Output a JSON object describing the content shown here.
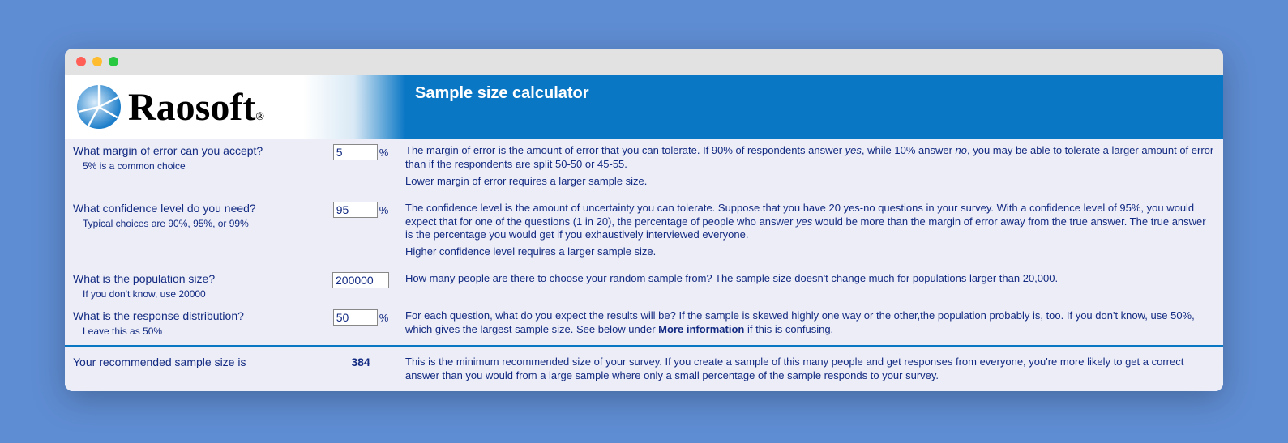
{
  "brand": {
    "name": "Raosoft",
    "registered": "®"
  },
  "header": {
    "title": "Sample size calculator"
  },
  "rows": {
    "margin": {
      "question": "What margin of error can you accept?",
      "hint": "5% is a common choice",
      "value": "5",
      "unit": "%",
      "desc_a": "The margin of error is the amount of error that you can tolerate. If 90% of respondents answer ",
      "desc_yes": "yes",
      "desc_b": ", while 10% answer ",
      "desc_no": "no",
      "desc_c": ", you may be able to tolerate a larger amount of error than if the respondents are split 50-50 or 45-55.",
      "desc_d": "Lower margin of error requires a larger sample size."
    },
    "confidence": {
      "question": "What confidence level do you need?",
      "hint": "Typical choices are 90%, 95%, or 99%",
      "value": "95",
      "unit": "%",
      "desc_a": "The confidence level is the amount of uncertainty you can tolerate. Suppose that you have 20 yes-no questions in your survey. With a confidence level of 95%, you would expect that for one of the questions (1 in 20), the percentage of people who answer ",
      "desc_yes": "yes",
      "desc_b": " would be more than the margin of error away from the true answer. The true answer is the percentage you would get if you exhaustively interviewed everyone.",
      "desc_c": "Higher confidence level requires a larger sample size."
    },
    "population": {
      "question": "What is the population size?",
      "hint": "If you don't know, use 20000",
      "value": "200000",
      "desc": "How many people are there to choose your random sample from? The sample size doesn't change much for populations larger than 20,000."
    },
    "response": {
      "question": "What is the response distribution?",
      "hint": "Leave this as 50%",
      "value": "50",
      "unit": "%",
      "desc_a": "For each question, what do you expect the results will be? If the sample is skewed highly one way or the other,the population probably is, too. If you don't know, use 50%, which gives the largest sample size. See below under ",
      "desc_bold": "More information",
      "desc_b": " if this is confusing."
    }
  },
  "result": {
    "label": "Your recommended sample size is",
    "value": "384",
    "desc": "This is the minimum recommended size of your survey. If you create a sample of this many people and get responses from everyone, you're more likely to get a correct answer than you would from a large sample where only a small percentage of the sample responds to your survey."
  }
}
